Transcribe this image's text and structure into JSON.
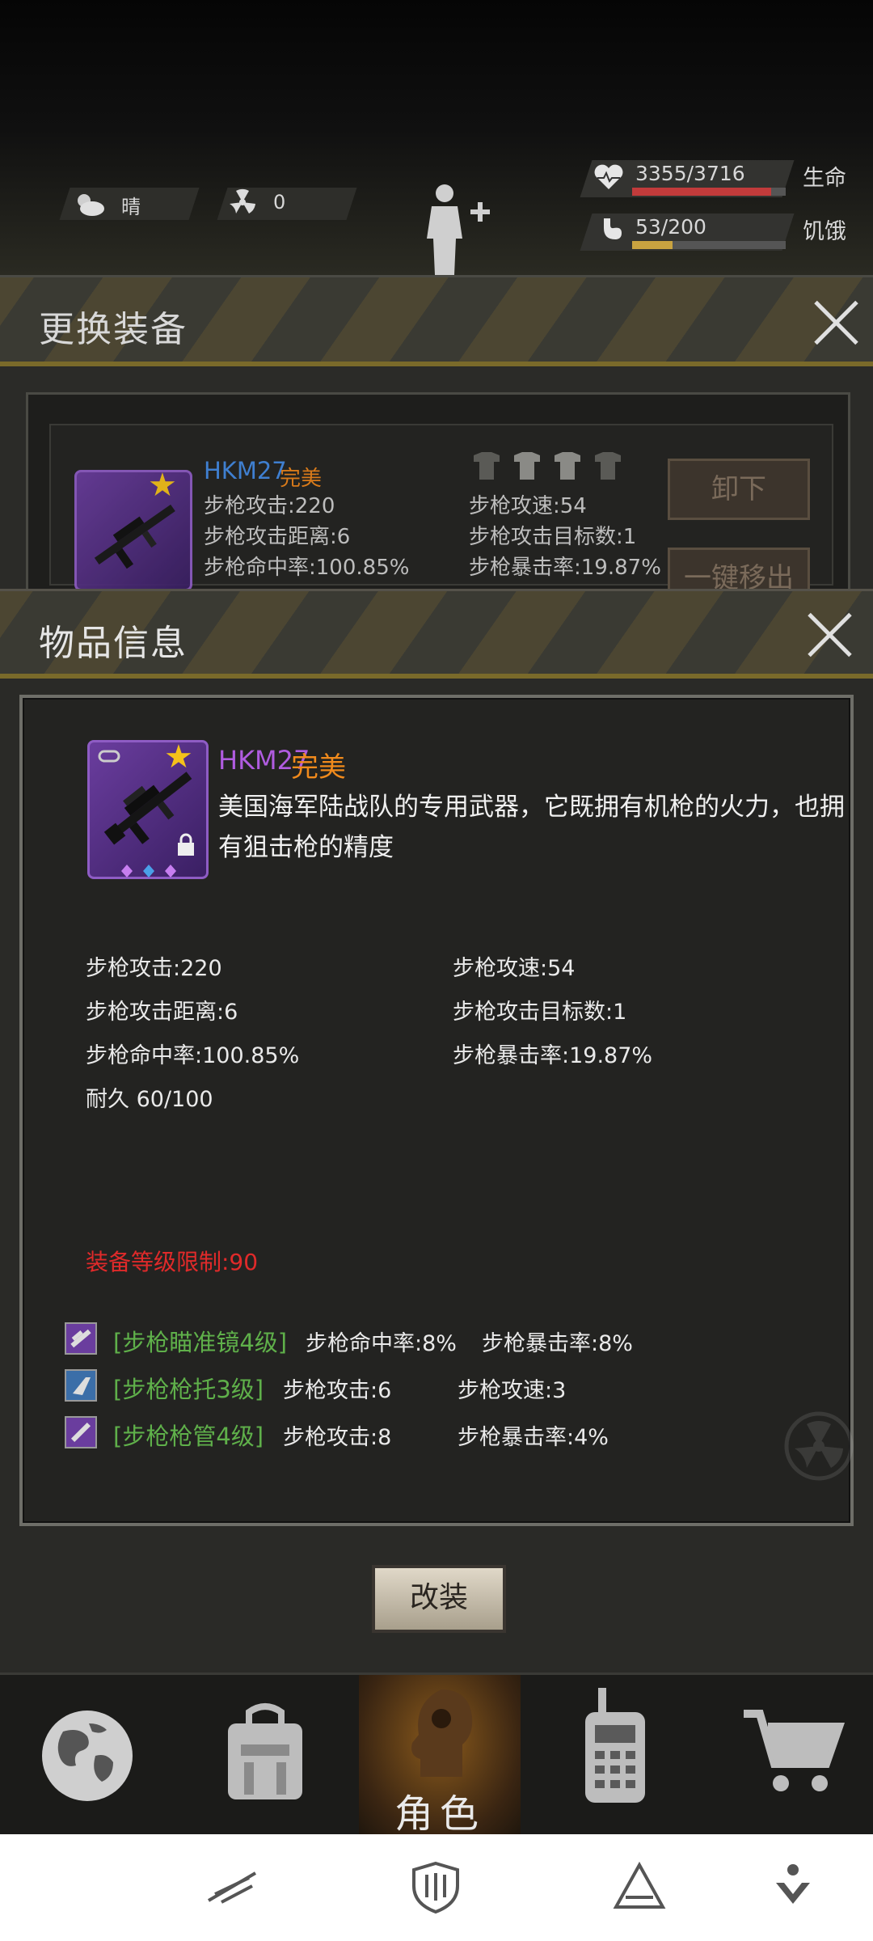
{
  "hud": {
    "weather_label": "晴",
    "radiation_value": "0",
    "hp_text": "3355/3716",
    "hp_label": "生命",
    "hp_fraction": 0.903,
    "hunger_text": "53/200",
    "hunger_label": "饥饿",
    "hunger_fraction": 0.265,
    "colors": {
      "hp": "#c23b3b",
      "hunger": "#c9a340"
    }
  },
  "equip_panel": {
    "title": "更换装备",
    "item_name": "HKM27",
    "item_quality": "完美",
    "stats_left": [
      "步枪攻击:220",
      "步枪攻击距离:6",
      "步枪命中率:100.85%"
    ],
    "stats_right": [
      "步枪攻速:54",
      "步枪攻击目标数:1",
      "步枪暴击率:19.87%"
    ],
    "unequip_button": "卸下",
    "remove_all_button": "一键移出"
  },
  "info_panel": {
    "title": "物品信息",
    "item_name": "HKM27",
    "item_quality": "完美",
    "description_line1": "美国海军陆战队的专用武器，它既拥有机枪的火力，也拥",
    "description_line2": "有狙击枪的精度",
    "stats_left": [
      "步枪攻击:220",
      "步枪攻击距离:6",
      "步枪命中率:100.85%",
      "耐久 60/100"
    ],
    "stats_right": [
      "步枪攻速:54",
      "步枪攻击目标数:1",
      "步枪暴击率:19.87%"
    ],
    "level_requirement": "装备等级限制:90",
    "mods": [
      {
        "name": "[步枪瞄准镜4级]",
        "stat1": "步枪命中率:8%",
        "stat2": "步枪暴击率:8%",
        "icon": "scope-icon",
        "color": "#6a3d9e"
      },
      {
        "name": "[步枪枪托3级]",
        "stat1": "步枪攻击:6",
        "stat2": "步枪攻速:3",
        "icon": "stock-icon",
        "color": "#3b6ea8"
      },
      {
        "name": "[步枪枪管4级]",
        "stat1": "步枪攻击:8",
        "stat2": "步枪暴击率:4%",
        "icon": "barrel-icon",
        "color": "#6a3d9e"
      }
    ],
    "modify_button": "改装",
    "colors": {
      "name": "#b05ce0",
      "quality": "#f08a1c",
      "requirement": "#e02a2a",
      "mod_name": "#5fb04a"
    }
  },
  "game_nav": {
    "items": [
      {
        "icon": "globe-icon"
      },
      {
        "icon": "backpack-icon"
      },
      {
        "icon": "character-icon",
        "label": "角色"
      },
      {
        "icon": "radio-icon"
      },
      {
        "icon": "cart-icon"
      }
    ]
  },
  "system_nav": {
    "icons": [
      "feather-icon",
      "shield-icon",
      "triangle-icon",
      "download-icon"
    ]
  }
}
